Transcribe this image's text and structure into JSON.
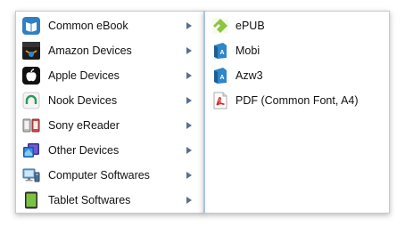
{
  "left_menu": {
    "items": [
      {
        "label": "Common eBook",
        "icon": "open-book-icon"
      },
      {
        "label": "Amazon Devices",
        "icon": "amazon-logo-icon"
      },
      {
        "label": "Apple Devices",
        "icon": "apple-logo-icon"
      },
      {
        "label": "Nook Devices",
        "icon": "nook-icon"
      },
      {
        "label": "Sony eReader",
        "icon": "sony-ereader-icon"
      },
      {
        "label": "Other Devices",
        "icon": "tablet-devices-icon"
      },
      {
        "label": "Computer Softwares",
        "icon": "computer-icon"
      },
      {
        "label": "Tablet Softwares",
        "icon": "green-tablet-icon"
      }
    ]
  },
  "right_menu": {
    "items": [
      {
        "label": "ePUB",
        "icon": "epub-icon"
      },
      {
        "label": "Mobi",
        "icon": "mobi-book-icon"
      },
      {
        "label": "Azw3",
        "icon": "azw3-book-icon"
      },
      {
        "label": "PDF (Common Font, A4)",
        "icon": "pdf-icon"
      }
    ]
  },
  "colors": {
    "submenu_arrow": "#5a6f90",
    "active_divider": "#a9c2ea",
    "epub_green": "#8dc63f",
    "book_blue": "#2f86c8",
    "pdf_red": "#d42a2a"
  }
}
